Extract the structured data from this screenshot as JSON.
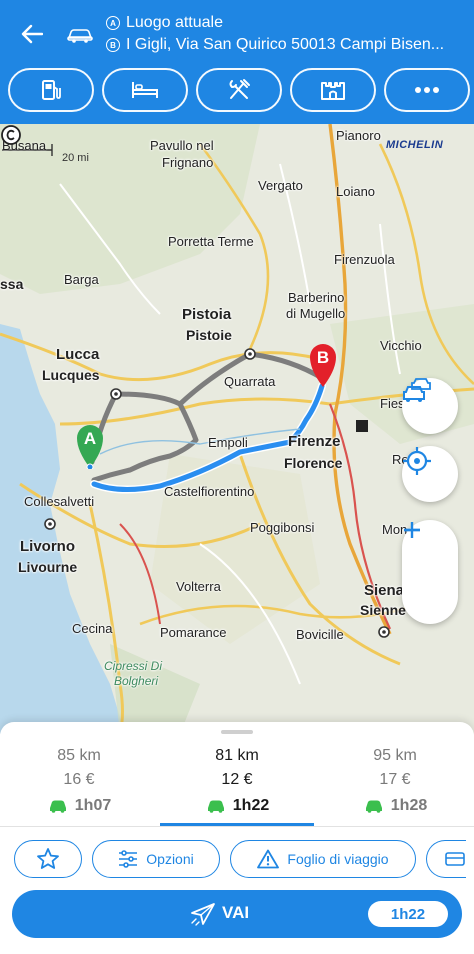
{
  "header": {
    "origin_badge": "A",
    "origin": "Luogo attuale",
    "destination_badge": "B",
    "destination": "I Gigli, Via San Quirico 50013 Campi Bisen..."
  },
  "poi_buttons": [
    {
      "icon": "fuel-pump-icon"
    },
    {
      "icon": "bed-icon"
    },
    {
      "icon": "restaurant-icon"
    },
    {
      "icon": "castle-icon"
    },
    {
      "icon": "more-icon"
    }
  ],
  "map": {
    "scale_km": "Busana",
    "scale_mi": "20 mi",
    "attribution": "MICHELIN",
    "labels": {
      "busana": "Busana",
      "pavullo": "Pavullo nel",
      "frignano": "Frignano",
      "pianoro": "Pianoro",
      "vergato": "Vergato",
      "loiano": "Loiano",
      "porretta": "Porretta Terme",
      "firenzuola": "Firenzuola",
      "ssa": "ssa",
      "barga": "Barga",
      "barberino": "Barberino",
      "mugello": "di Mugello",
      "pistoia": "Pistoia",
      "pistoie": "Pistoie",
      "vicchio": "Vicchio",
      "lucca": "Lucca",
      "lucques": "Lucques",
      "quarrata": "Quarrata",
      "fies": "Fies",
      "empoli": "Empoli",
      "firenze": "Firenze",
      "florence": "Florence",
      "re": "Re",
      "collesalvetti": "Collesalvetti",
      "castelfiorentino": "Castelfiorentino",
      "livorno": "Livorno",
      "livourne": "Livourne",
      "mon": "Mon",
      "poggibonsi": "Poggibonsi",
      "volterra": "Volterra",
      "siena": "Siena",
      "sienne": "Sienne",
      "cecina": "Cecina",
      "pomarance": "Pomarance",
      "bovicille": "Bovicille",
      "cipressi": "Cipressi Di",
      "bolgheri": "Bolgheri"
    },
    "marker_a": "A",
    "marker_b": "B"
  },
  "routes": [
    {
      "distance": "85 km",
      "cost": "16 €",
      "time": "1h07"
    },
    {
      "distance": "81 km",
      "cost": "12 €",
      "time": "1h22"
    },
    {
      "distance": "95 km",
      "cost": "17 €",
      "time": "1h28"
    }
  ],
  "actions": {
    "options": "Opzioni",
    "roadbook": "Foglio di viaggio"
  },
  "go": {
    "label": "VAI",
    "time": "1h22"
  },
  "colors": {
    "primary": "#1f86e3",
    "route_selected": "#2a8ef0",
    "route_alt": "#7d7d7d",
    "marker_a": "#34a853",
    "marker_b": "#e3202a",
    "green_car": "#3bbf4e"
  }
}
